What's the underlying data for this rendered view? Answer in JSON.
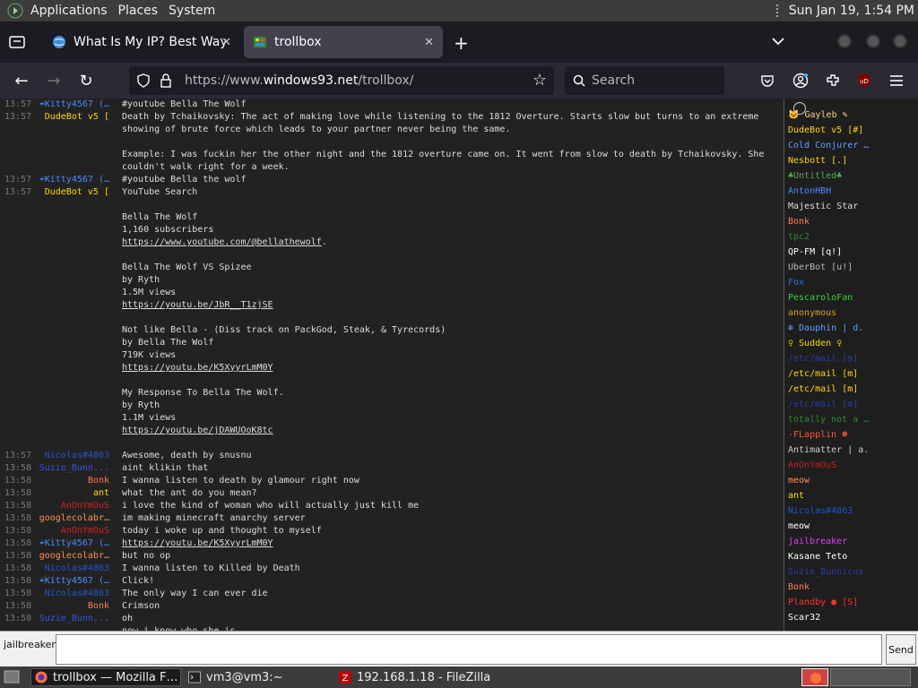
{
  "gnome": {
    "applications": "Applications",
    "places": "Places",
    "system": "System",
    "clock": "Sun Jan 19,  1:54 PM"
  },
  "tabs": [
    {
      "title": "What Is My IP? Best Way To",
      "close": "✕"
    },
    {
      "title": "trollbox",
      "close": "✕"
    }
  ],
  "new_tab": "+",
  "url": {
    "prefix": "https://www.",
    "host": "windows93.net",
    "path": "/trollbox/"
  },
  "search": {
    "placeholder": "Search"
  },
  "chat": [
    {
      "time": "13:57",
      "nick": "☔Kitty4567 (…",
      "color": "#4a8cff",
      "msg": "#youtube Bella The Wolf"
    },
    {
      "time": "13:57",
      "nick": "DudeBot v5 [",
      "color": "#ffd700",
      "msg": "Death by Tchaikovsky: The act of making love while listening to the 1812 Overture. Starts slow but turns to an extreme showing of brute force which leads to your partner never being the same.\n\nExample: I was fuckin her the other night and the 1812 overture came on. It went from slow to death by Tchaikovsky. She couldn't walk right for a week."
    },
    {
      "time": "13:57",
      "nick": "☔Kitty4567 (…",
      "color": "#4a8cff",
      "msg": "#youtube Bella the wolf"
    },
    {
      "time": "13:57",
      "nick": "DudeBot v5 [",
      "color": "#ffd700",
      "msg": "YouTube Search\n\nBella The Wolf\n1,160 subscribers\n",
      "link": "https://www.youtube.com/@bellathewolf",
      "after": "."
    },
    {
      "time": "",
      "nick": "",
      "color": "#ddd",
      "msg": "Bella The Wolf VS Spizee\nby Ryth\n1.5M views\n",
      "link": "https://youtu.be/JbR__T1zjSE"
    },
    {
      "time": "",
      "nick": "",
      "color": "#ddd",
      "msg": "Not like Bella - (Diss track on PackGod, Steak, & Tyrecords)\nby Bella The Wolf\n719K views\n",
      "link": "https://youtu.be/K5XyyrLmM0Y"
    },
    {
      "time": "",
      "nick": "",
      "color": "#ddd",
      "msg": "My Response To Bella The Wolf.\nby Ryth\n1.1M views\n",
      "link": "https://youtu.be/jDAWUOoK8tc"
    },
    {
      "time": "13:57",
      "nick": "Nicolas#4863",
      "color": "#2255cc",
      "msg": "Awesome, death by snusnu"
    },
    {
      "time": "13:58",
      "nick": "Suzie_Bunn...",
      "color": "#3355dd",
      "msg": "aint klikin that"
    },
    {
      "time": "13:58",
      "nick": "Bonk",
      "color": "#ff7b54",
      "msg": "I wanna listen to death by glamour right now"
    },
    {
      "time": "13:58",
      "nick": "ant",
      "color": "#ffd700",
      "msg": "what the ant do you mean?"
    },
    {
      "time": "13:58",
      "nick": "AnOnYmOuS",
      "color": "#d42020",
      "msg": "i love the kind of woman who will actually just kill me"
    },
    {
      "time": "13:58",
      "nick": "googlecolabr…",
      "color": "#ff9050",
      "msg": "im making minecraft anarchy server"
    },
    {
      "time": "13:58",
      "nick": "AnOnYmOuS",
      "color": "#d42020",
      "msg": "today i woke up and thought to myself"
    },
    {
      "time": "13:58",
      "nick": "☔Kitty4567 (…",
      "color": "#4a8cff",
      "msg": "",
      "link": "https://youtu.be/K5XyyrLmM0Y"
    },
    {
      "time": "13:58",
      "nick": "googlecolabr…",
      "color": "#ff9050",
      "msg": "but no op"
    },
    {
      "time": "13:58",
      "nick": "Nicolas#4863",
      "color": "#2255cc",
      "msg": "I wanna listen to Killed by Death"
    },
    {
      "time": "13:58",
      "nick": "☔Kitty4567 (…",
      "color": "#4a8cff",
      "msg": "Click!"
    },
    {
      "time": "13:58",
      "nick": "Nicolas#4863",
      "color": "#2255cc",
      "msg": "The only way I can ever die"
    },
    {
      "time": "13:58",
      "nick": "Bonk",
      "color": "#ff7b54",
      "msg": "Crimson"
    },
    {
      "time": "13:58",
      "nick": "Suzie_Bunn...",
      "color": "#3355dd",
      "msg": "oh"
    },
    {
      "time": "",
      "nick": "",
      "color": "#ddd",
      "msg": "now i know who she is"
    }
  ],
  "users": [
    {
      "name": "🐱 Gayleb ✎",
      "color": "#ffd27f"
    },
    {
      "name": "DudeBot v5 [#]",
      "color": "#ffd700"
    },
    {
      "name": "Cold Conjurer …",
      "color": "#6b9bff"
    },
    {
      "name": "Nesbott [.]",
      "color": "#ffd700"
    },
    {
      "name": "♣Untitled♣",
      "color": "#55aa55"
    },
    {
      "name": "AntonHBH",
      "color": "#4a8cff"
    },
    {
      "name": "Majestic Star",
      "color": "#dddddd"
    },
    {
      "name": "Bonk",
      "color": "#ff7b54"
    },
    {
      "name": "tpc2",
      "color": "#2e8b2e"
    },
    {
      "name": "QP-FM [q!]",
      "color": "#ffffff"
    },
    {
      "name": "UberBot [u!]",
      "color": "#bbbbbb"
    },
    {
      "name": "Fox",
      "color": "#2f6fd6"
    },
    {
      "name": "PescaroloFan",
      "color": "#3ecf3e"
    },
    {
      "name": "anonymous",
      "color": "#d4a017"
    },
    {
      "name": "❄ Dauphin | d.",
      "color": "#5aa0ff"
    },
    {
      "name": "♀ Sudden ♀",
      "color": "#ffd700"
    },
    {
      "name": "/etc/mail [m]",
      "color": "#2a3fa8"
    },
    {
      "name": "/etc/mail [m]",
      "color": "#ffd700"
    },
    {
      "name": "/etc/mail [m]",
      "color": "#ffd700"
    },
    {
      "name": "/etc/mail [m]",
      "color": "#2a3fa8"
    },
    {
      "name": "totally not a …",
      "color": "#2e8b2e"
    },
    {
      "name": "-FLapplin ☻",
      "color": "#ff5533"
    },
    {
      "name": "Antimatter | a.",
      "color": "#cccccc"
    },
    {
      "name": "AnOnYmOuS",
      "color": "#c81e1e"
    },
    {
      "name": "meow",
      "color": "#ff9050"
    },
    {
      "name": "ant",
      "color": "#ffd700"
    },
    {
      "name": "Nicolas#4863",
      "color": "#2255cc"
    },
    {
      "name": "meow",
      "color": "#ffffff"
    },
    {
      "name": "jailbreaker",
      "color": "#e040fb"
    },
    {
      "name": "Kasane Teto",
      "color": "#ffffff"
    },
    {
      "name": "Suzie_Bunnicus",
      "color": "#2a3fa8"
    },
    {
      "name": "Bonk",
      "color": "#ff7b54"
    },
    {
      "name": "Plandby ● [S]",
      "color": "#ff3333"
    },
    {
      "name": "Scar32",
      "color": "#ffffff"
    }
  ],
  "input": {
    "me": "jailbreaker",
    "value": "",
    "send": "Send"
  },
  "taskbar": [
    {
      "label": "trollbox — Mozilla F…"
    },
    {
      "label": "vm3@vm3:~"
    },
    {
      "label": "192.168.1.18 - FileZilla"
    }
  ],
  "colors": {
    "bg": "#222222",
    "accent": "#42414d"
  }
}
